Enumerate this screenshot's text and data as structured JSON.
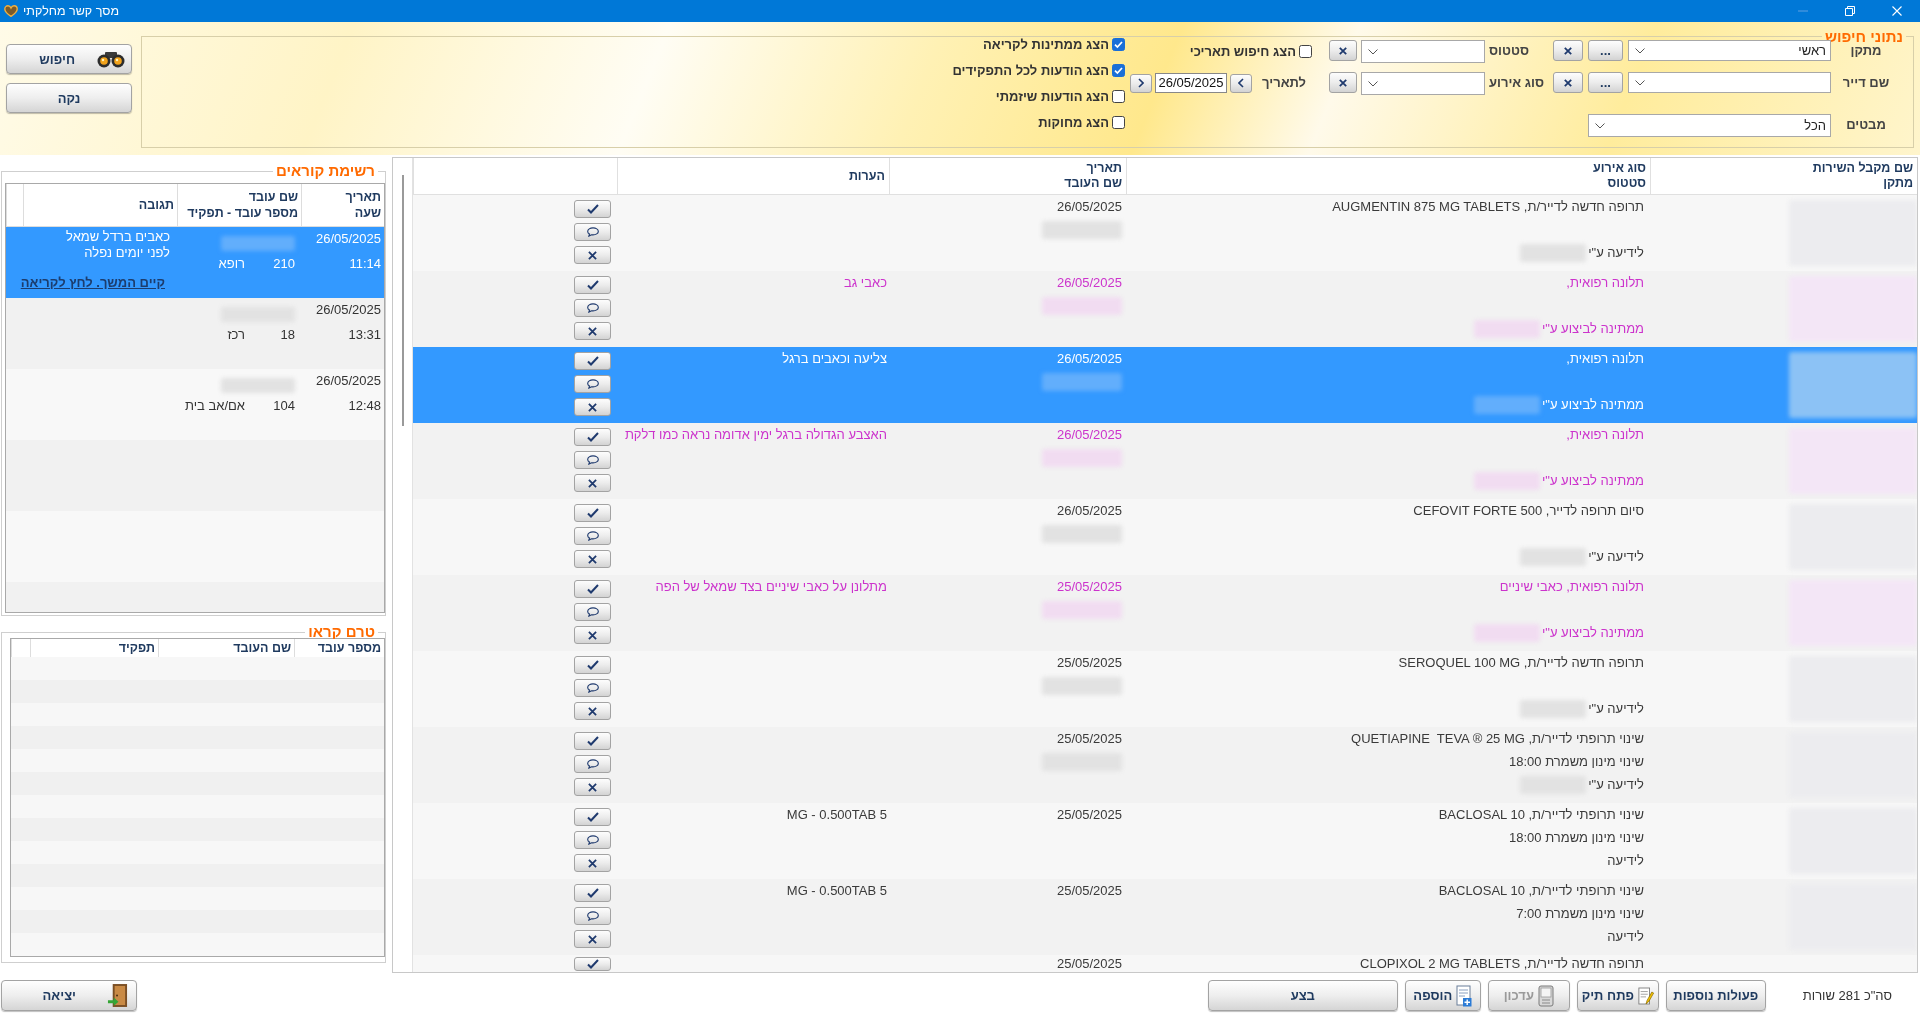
{
  "window": {
    "title": "מסך קשר מחלקתי"
  },
  "actions": {
    "search": "חיפוש",
    "clear": "נקה"
  },
  "search": {
    "title": "נתוני חיפוש",
    "fields": [
      {
        "kind": "lookup",
        "label": "מתקן",
        "value": "ראשי",
        "browse": "..."
      },
      {
        "kind": "lookup",
        "label": "שם דייר",
        "browse": "..."
      },
      {
        "kind": "select",
        "label": "מבטים",
        "value": "הכל"
      }
    ],
    "filters": [
      {
        "label": "סטטוס"
      },
      {
        "label": "סוג אירוע"
      }
    ],
    "date_search": {
      "label": "הצג חיפוש תאריכי",
      "checked": false
    },
    "to_date": {
      "label": "לתאריך",
      "value": "26/05/2025"
    },
    "options": [
      {
        "label": "הצג ממתינות לקריאה",
        "checked": true
      },
      {
        "label": "הצג הודעות לכל התפקידים",
        "checked": true
      },
      {
        "label": "הצג הודעות שיזמתי",
        "checked": false
      },
      {
        "label": "הצג מחוקות",
        "checked": false
      }
    ]
  },
  "messages": {
    "columns": [
      {
        "lines": [
          "שם מקבל השירות",
          "מתקן"
        ]
      },
      {
        "lines": [
          "סוג אירוע",
          "סטטוס"
        ]
      },
      {
        "lines": [
          "תאריך",
          "שם העובד"
        ]
      },
      {
        "lines": [
          "הערות"
        ]
      }
    ],
    "rows": [
      {
        "kind": "notice",
        "selected": false,
        "partial": false,
        "recipient_redacted": true,
        "event": "תרופה חדשה לדייר/ת, AUGMENTIN 875 MG TABLETS",
        "status": "לידיעה ע\"י",
        "status_redacted": true,
        "date": "26/05/2025",
        "worker_redacted": true
      },
      {
        "kind": "complaint",
        "selected": false,
        "partial": false,
        "recipient_redacted": true,
        "event": "תלונה רפואית,",
        "status": "ממתינה לביצוע ע\"י",
        "status_redacted": true,
        "date": "26/05/2025",
        "worker_redacted": true,
        "note": "כאבי גב"
      },
      {
        "kind": "complaint",
        "selected": true,
        "partial": false,
        "recipient_redacted": true,
        "event": "תלונה רפואית,",
        "status": "ממתינה לביצוע ע\"י",
        "status_redacted": true,
        "date": "26/05/2025",
        "worker_redacted": true,
        "note": "צליעה וכאבים ברגל"
      },
      {
        "kind": "complaint",
        "selected": false,
        "partial": false,
        "recipient_redacted": true,
        "event": "תלונה רפואית,",
        "status": "ממתינה לביצוע ע\"י",
        "status_redacted": true,
        "date": "26/05/2025",
        "worker_redacted": true,
        "note": "האצבע הגדולה ברגל ימין אדומה נראה כמו דלקת"
      },
      {
        "kind": "notice",
        "selected": false,
        "partial": false,
        "recipient_redacted": true,
        "event": "סיום תרופה לדייר, CEFOVIT FORTE 500",
        "status": "לידיעה ע\"י",
        "status_redacted": true,
        "date": "26/05/2025",
        "worker_redacted": true
      },
      {
        "kind": "complaint",
        "selected": false,
        "partial": false,
        "recipient_redacted": true,
        "event": "תלונה רפואית, כאבי שיניים",
        "status": "ממתינה לביצוע ע\"י",
        "status_redacted": true,
        "date": "25/05/2025",
        "worker_redacted": true,
        "note": "מתלונן על כאבי שיניים בצד שמאל של הפה"
      },
      {
        "kind": "notice",
        "selected": false,
        "partial": false,
        "recipient_redacted": true,
        "event": "תרופה חדשה לדייר/ת, SEROQUEL 100 MG",
        "status": "לידיעה ע\"י",
        "status_redacted": true,
        "date": "25/05/2025",
        "worker_redacted": true
      },
      {
        "kind": "notice",
        "selected": false,
        "partial": false,
        "recipient_redacted": true,
        "event": "שינוי תרופתי לדייר/ת, QUETIAPINE  TEVA ® 25 MG",
        "detail": "שינוי מינון משמרת 18:00",
        "status": "לידיעה ע\"י",
        "status_redacted": true,
        "date": "25/05/2025",
        "worker_redacted": true
      },
      {
        "kind": "notice",
        "selected": false,
        "partial": false,
        "recipient_redacted": true,
        "event": "שינוי תרופתי לדייר/ת, BACLOSAL 10",
        "detail": "שינוי מינון משמרת 18:00",
        "status": "לידיעה",
        "status_redacted": false,
        "date": "25/05/2025",
        "worker_redacted": false,
        "note": "5 MG - 0.500TAB"
      },
      {
        "kind": "notice",
        "selected": false,
        "partial": false,
        "recipient_redacted": true,
        "event": "שינוי תרופתי לדייר/ת, BACLOSAL 10",
        "detail": "שינוי מינון משמרת 7:00",
        "status": "לידיעה",
        "status_redacted": false,
        "date": "25/05/2025",
        "worker_redacted": false,
        "note": "5 MG - 0.500TAB"
      },
      {
        "kind": "notice",
        "selected": false,
        "partial": true,
        "event": "תרופה חדשה לדייר/ת, CLOPIXOL 2 MG TABLETS",
        "date": "25/05/2025"
      }
    ]
  },
  "readers": {
    "title": "רשימת קוראים",
    "columns": [
      {
        "lines": [
          "תאריך",
          "שעה"
        ]
      },
      {
        "lines": [
          "שם עובד",
          "מספר עובד - תפקיד"
        ]
      },
      {
        "lines": [
          "תגובה"
        ]
      }
    ],
    "rows": [
      {
        "selected": true,
        "date": "26/05/2025",
        "time": "11:14",
        "name_redacted": true,
        "number": "210",
        "role": "רופא",
        "response": "כאבים ברדל שמאל\nלפני יומים נפלה",
        "link": "קיים המשך. לחץ לקריאה"
      },
      {
        "selected": false,
        "date": "26/05/2025",
        "time": "13:31",
        "name_redacted": true,
        "number": "18",
        "role": "רכז"
      },
      {
        "selected": false,
        "date": "26/05/2025",
        "time": "12:48",
        "name_redacted": true,
        "number": "104",
        "role": "אם/אב בית"
      }
    ]
  },
  "not_read": {
    "title": "טרם קראו",
    "columns": [
      "מספר עובד",
      "שם העובד",
      "תפקיד"
    ]
  },
  "footer": {
    "exit": "יציאה",
    "total": "סה\"כ 281 שורות",
    "buttons": [
      {
        "kind": "plain",
        "label": "פעולות נוספות",
        "disabled": false
      },
      {
        "kind": "pencil",
        "label": "פתח תיק",
        "disabled": false
      },
      {
        "kind": "document",
        "label": "עדכון",
        "disabled": true
      },
      {
        "kind": "add",
        "label": "הוספה",
        "disabled": false
      },
      {
        "kind": "plain",
        "label": "בצע",
        "disabled": false
      }
    ]
  }
}
